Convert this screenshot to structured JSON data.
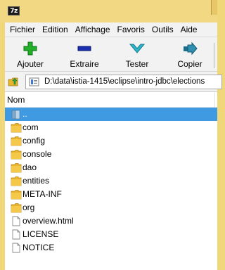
{
  "window": {
    "app_badge": "7z"
  },
  "menu": {
    "items": [
      "Fichier",
      "Edition",
      "Affichage",
      "Favoris",
      "Outils",
      "Aide"
    ]
  },
  "toolbar": {
    "buttons": [
      {
        "label": "Ajouter",
        "icon": "plus-icon",
        "color": "#22b02a"
      },
      {
        "label": "Extraire",
        "icon": "minus-icon",
        "color": "#1a2fb0"
      },
      {
        "label": "Tester",
        "icon": "check-chevron-icon",
        "color": "#2aa3b8"
      },
      {
        "label": "Copier",
        "icon": "copy-arrow-icon",
        "color": "#2f8fb0"
      }
    ]
  },
  "address": {
    "path": "D:\\data\\istia-1415\\eclipse\\intro-jdbc\\elections"
  },
  "filelist": {
    "column_name": "Nom",
    "selected_color": "#3f9ae1",
    "rows": [
      {
        "name": "..",
        "type": "parent",
        "selected": true
      },
      {
        "name": "com",
        "type": "folder"
      },
      {
        "name": "config",
        "type": "folder"
      },
      {
        "name": "console",
        "type": "folder"
      },
      {
        "name": "dao",
        "type": "folder"
      },
      {
        "name": "entities",
        "type": "folder"
      },
      {
        "name": "META-INF",
        "type": "folder"
      },
      {
        "name": "org",
        "type": "folder"
      },
      {
        "name": "overview.html",
        "type": "file"
      },
      {
        "name": "LICENSE",
        "type": "file"
      },
      {
        "name": "NOTICE",
        "type": "file"
      }
    ]
  }
}
